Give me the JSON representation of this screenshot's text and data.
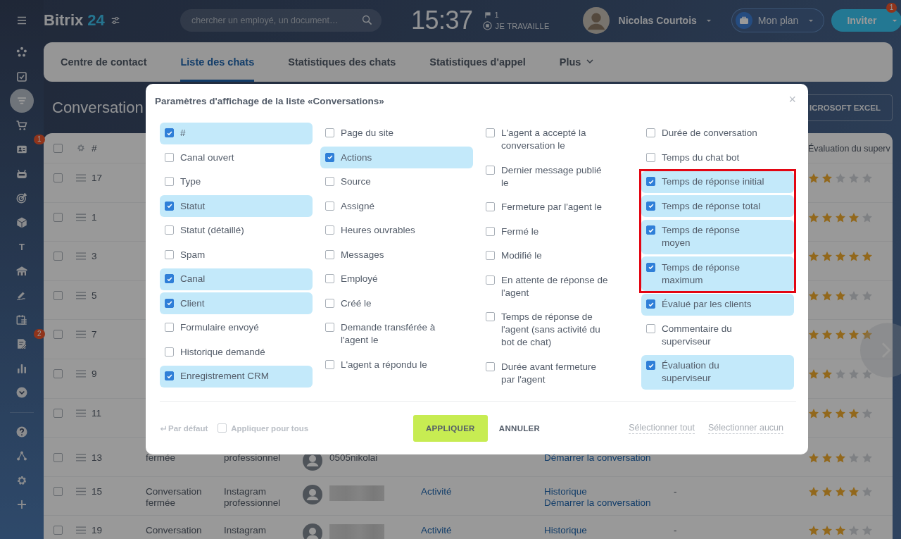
{
  "sidebar": {
    "items": [
      {
        "kind": "menu",
        "selected": false
      },
      {
        "kind": "feed",
        "selected": false
      },
      {
        "kind": "tasks",
        "selected": false
      },
      {
        "kind": "filter",
        "selected": true
      },
      {
        "kind": "cart",
        "selected": false
      },
      {
        "kind": "contact",
        "selected": false,
        "badge": "1"
      },
      {
        "kind": "robot",
        "selected": false
      },
      {
        "kind": "target",
        "selected": false
      },
      {
        "kind": "box",
        "selected": false
      },
      {
        "kind": "letter",
        "selected": false,
        "glyph": "T"
      },
      {
        "kind": "bank",
        "selected": false
      },
      {
        "kind": "sign",
        "selected": false
      },
      {
        "kind": "calendar",
        "selected": false
      },
      {
        "kind": "docs",
        "selected": false,
        "badge": "2"
      },
      {
        "kind": "chart",
        "selected": false
      },
      {
        "kind": "more",
        "selected": false
      }
    ],
    "bottom_items": [
      {
        "kind": "help",
        "selected": false
      },
      {
        "kind": "network",
        "selected": false
      },
      {
        "kind": "gear",
        "selected": false
      },
      {
        "kind": "plus",
        "selected": false
      }
    ]
  },
  "header": {
    "logo": {
      "name": "Bitrix",
      "number": "24"
    },
    "search": {
      "placeholder": "chercher un employé, un document…"
    },
    "clock": "15:37",
    "flag_count": "1",
    "work_status": "JE TRAVAILLE",
    "user": {
      "name": "Nicolas Courtois"
    },
    "plan_button": "Mon plan",
    "invite_button": {
      "label": "Inviter",
      "badge": "1"
    }
  },
  "tabs": [
    {
      "label": "Centre de contact",
      "selected": false
    },
    {
      "label": "Liste des chats",
      "selected": true
    },
    {
      "label": "Statistiques des chats",
      "selected": false
    },
    {
      "label": "Statistiques d'appel",
      "selected": false
    },
    {
      "label": "Plus",
      "selected": false
    }
  ],
  "page_title": "Conversation",
  "export_button": "ICROSOFT EXCEL",
  "table": {
    "header": {
      "checked": false,
      "number": "#",
      "rating": "Évaluation du superv"
    },
    "rows": [
      {
        "checked": false,
        "number": "17",
        "stars": 2
      },
      {
        "checked": false,
        "number": "1",
        "stars": 4
      },
      {
        "checked": false,
        "number": "3",
        "stars": 5
      },
      {
        "checked": false,
        "number": "5",
        "stars": 3
      },
      {
        "checked": false,
        "number": "7",
        "stars": 5
      },
      {
        "checked": false,
        "number": "9",
        "stars": 2
      },
      {
        "checked": false,
        "number": "11",
        "stars": 4
      },
      {
        "checked": false,
        "number": "13",
        "covered_top": true,
        "status": "fermée",
        "channel": "professionnel",
        "contact": {
          "name": "0505nikolai"
        },
        "actions": [
          "Démarrer la conversation"
        ],
        "stars": 3
      },
      {
        "checked": false,
        "number": "15",
        "status": "Conversation fermée",
        "channel": "Instagram professionnel",
        "contact": {
          "redacted": true
        },
        "activity": "Activité",
        "actions": [
          "Historique",
          "Démarrer la conversation"
        ],
        "dash": "-",
        "stars": 4
      },
      {
        "checked": false,
        "number": "19",
        "status": "Conversation",
        "channel": "Instagram",
        "contact": {
          "redacted": true
        },
        "activity": "Activité",
        "actions": [
          "Historique"
        ],
        "dash": "-",
        "stars": 3
      }
    ]
  },
  "dialog": {
    "title": "Paramètres d'affichage de la liste «Conversations»",
    "close": "×",
    "columns": [
      {
        "items": [
          {
            "label": "#",
            "checked": true,
            "highlighted": false
          },
          {
            "label": "Canal ouvert",
            "checked": false,
            "highlighted": false
          },
          {
            "label": "Type",
            "checked": false,
            "highlighted": false
          },
          {
            "label": "Statut",
            "checked": true,
            "highlighted": false
          },
          {
            "label": "Statut (détaillé)",
            "checked": false,
            "highlighted": false
          },
          {
            "label": "Spam",
            "checked": false,
            "highlighted": false
          },
          {
            "label": "Canal",
            "checked": true,
            "highlighted": false
          },
          {
            "label": "Client",
            "checked": true,
            "highlighted": false
          },
          {
            "label": "Formulaire envoyé",
            "checked": false,
            "highlighted": false
          },
          {
            "label": "Historique demandé",
            "checked": false,
            "highlighted": false
          },
          {
            "label": "Enregistrement CRM",
            "checked": true,
            "highlighted": false
          }
        ]
      },
      {
        "items": [
          {
            "label": "Page du site",
            "checked": false,
            "highlighted": false
          },
          {
            "label": "Actions",
            "checked": true,
            "highlighted": false
          },
          {
            "label": "Source",
            "checked": false,
            "highlighted": false
          },
          {
            "label": "Assigné",
            "checked": false,
            "highlighted": false
          },
          {
            "label": "Heures ouvrables",
            "checked": false,
            "highlighted": false
          },
          {
            "label": "Messages",
            "checked": false,
            "highlighted": false
          },
          {
            "label": "Employé",
            "checked": false,
            "highlighted": false
          },
          {
            "label": "Créé le",
            "checked": false,
            "highlighted": false
          },
          {
            "label": "Demande transférée à l'agent le",
            "checked": false,
            "highlighted": false
          },
          {
            "label": "L'agent a répondu le",
            "checked": false,
            "highlighted": false
          }
        ]
      },
      {
        "items": [
          {
            "label": "L'agent a accepté la conversation le",
            "checked": false,
            "highlighted": false
          },
          {
            "label": "Dernier message publié le",
            "checked": false,
            "highlighted": false
          },
          {
            "label": "Fermeture par l'agent le",
            "checked": false,
            "highlighted": false
          },
          {
            "label": "Fermé le",
            "checked": false,
            "highlighted": false
          },
          {
            "label": "Modifié le",
            "checked": false,
            "highlighted": false
          },
          {
            "label": "En attente de réponse de l'agent",
            "checked": false,
            "highlighted": false
          },
          {
            "label": "Temps de réponse de l'agent (sans activité du bot de chat)",
            "checked": false,
            "highlighted": false
          },
          {
            "label": "Durée avant fermeture par l'agent",
            "checked": false,
            "highlighted": false
          }
        ]
      },
      {
        "items": [
          {
            "label": "Durée de conversation",
            "checked": false,
            "highlighted": false
          },
          {
            "label": "Temps du chat bot",
            "checked": false,
            "highlighted": false
          },
          {
            "label": "Temps de réponse initial",
            "checked": true,
            "highlighted": true
          },
          {
            "label": "Temps de réponse total",
            "checked": true,
            "highlighted": true
          },
          {
            "label": "Temps de réponse moyen",
            "checked": true,
            "highlighted": true
          },
          {
            "label": "Temps de réponse maximum",
            "checked": true,
            "highlighted": true
          },
          {
            "label": "Évalué par les clients",
            "checked": true,
            "highlighted": false
          },
          {
            "label": "Commentaire du superviseur",
            "checked": false,
            "highlighted": false
          },
          {
            "label": "Évaluation du superviseur",
            "checked": true,
            "highlighted": false
          }
        ]
      }
    ],
    "footer": {
      "reset": "Par défaut",
      "apply_all": {
        "label": "Appliquer pour tous",
        "checked": false
      },
      "apply": "APPLIQUER",
      "cancel": "ANNULER",
      "select_all": "Sélectionner tout",
      "select_none": "Sélectionner aucun"
    }
  }
}
